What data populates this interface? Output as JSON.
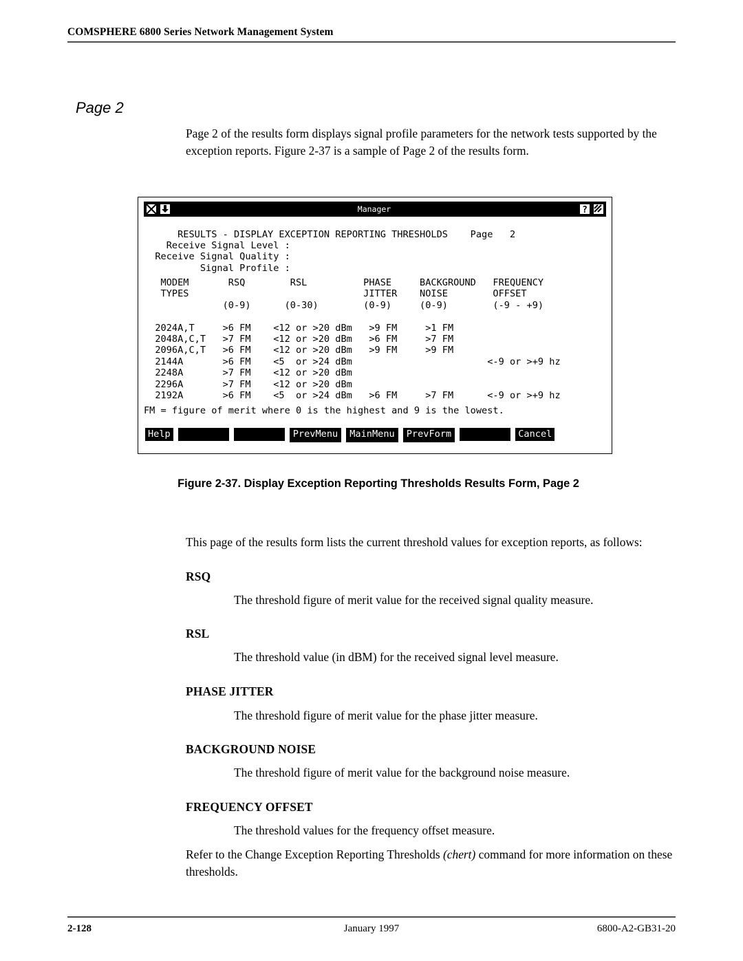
{
  "running_head": "COMSPHERE 6800 Series Network Management System",
  "section_heading": "Page 2",
  "intro_paragraph": "Page 2 of the results form displays signal profile parameters for the network tests supported by the exception reports. Figure 2-37 is a sample of Page 2 of the results form.",
  "figure": {
    "caption": "Figure 2-37. Display Exception Reporting Thresholds Results Form, Page 2",
    "window": {
      "title": "Manager",
      "close_icon": "close-box-icon",
      "minimize_icon": "minimize-box-icon",
      "help_icon": "question-mark-icon",
      "resize_icon": "resize-box-icon"
    },
    "form_title": "RESULTS - DISPLAY EXCEPTION REPORTING THRESHOLDS    Page   2",
    "field_labels": [
      "    Receive Signal Level :",
      "  Receive Signal Quality :",
      "          Signal Profile :"
    ],
    "table": {
      "header_rows": [
        "   MODEM       RSQ        RSL          PHASE     BACKGROUND   FREQUENCY",
        "   TYPES                               JITTER    NOISE        OFFSET",
        "              (0-9)      (0-30)        (0-9)     (0-9)        (-9 - +9)"
      ],
      "data_rows": [
        "  2024A,T     >6 FM    <12 or >20 dBm   >9 FM     >1 FM",
        "  2048A,C,T   >7 FM    <12 or >20 dBm   >6 FM     >7 FM",
        "  2096A,C,T   >6 FM    <12 or >20 dBm   >9 FM     >9 FM",
        "  2144A       >6 FM    <5  or >24 dBm                        <-9 or >+9 hz",
        "  2248A       >7 FM    <12 or >20 dBm",
        "  2296A       >7 FM    <12 or >20 dBm",
        "  2192A       >6 FM    <5  or >24 dBm   >6 FM     >7 FM      <-9 or >+9 hz"
      ],
      "footnote": "FM = figure of merit where 0 is the highest and 9 is the lowest."
    },
    "buttons": [
      {
        "label": "Help",
        "blank": false,
        "framed": false
      },
      {
        "label": "",
        "blank": true,
        "framed": false
      },
      {
        "label": "",
        "blank": true,
        "framed": false
      },
      {
        "label": "PrevMenu",
        "blank": false,
        "framed": true
      },
      {
        "label": "MainMenu",
        "blank": false,
        "framed": true
      },
      {
        "label": "PrevForm",
        "blank": false,
        "framed": true
      },
      {
        "label": "",
        "blank": true,
        "framed": false
      },
      {
        "label": "Cancel",
        "blank": false,
        "framed": false
      }
    ]
  },
  "lead_paragraph": "This page of the results form lists the current threshold values for exception reports, as follows:",
  "definitions": [
    {
      "term": "RSQ",
      "text": "The threshold figure of merit value for the received signal quality measure."
    },
    {
      "term": "RSL",
      "text": "The threshold value (in dBM) for the received signal level measure."
    },
    {
      "term": "PHASE JITTER",
      "text": "The threshold figure of merit value for the phase jitter measure."
    },
    {
      "term": "BACKGROUND NOISE",
      "text": "The threshold figure of merit value for the background noise measure."
    },
    {
      "term": "FREQUENCY OFFSET",
      "text": "The threshold values for the frequency offset measure."
    }
  ],
  "closing_paragraph": {
    "before": "Refer to the Change Exception Reporting Thresholds ",
    "italic": "(chert)",
    "after": " command for more information on these thresholds."
  },
  "footer": {
    "page_number": "2-128",
    "date": "January 1997",
    "document_number": "6800-A2-GB31-20"
  }
}
